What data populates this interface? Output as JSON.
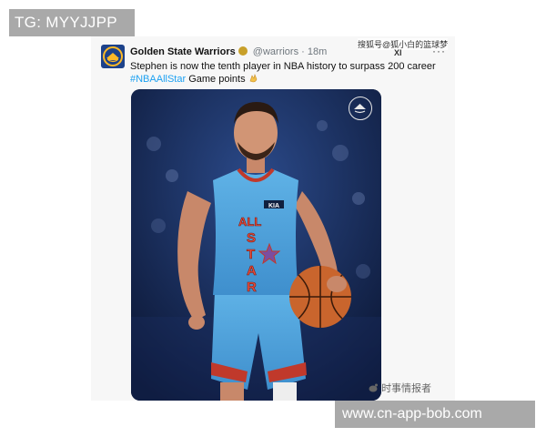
{
  "overlay": {
    "tg_label": "TG: MYYJJPP",
    "url_label": "www.cn-app-bob.com"
  },
  "tweet": {
    "author": "Golden State Warriors",
    "handle": "@warriors",
    "separator": "·",
    "time": "18m",
    "more": "···",
    "text": "Stephen is now the tenth player in NBA history to surpass 200 career",
    "hashtag": "#NBAAllStar",
    "text_tail": "Game points",
    "emoji_name": "clapping-hands-icon",
    "verified_color": "#c8a02a",
    "brand_color": "#1d428a"
  },
  "photo": {
    "jersey_letters": [
      "ALL",
      "S",
      "T",
      "A",
      "R"
    ],
    "sponsor": "KIA"
  },
  "watermarks": {
    "top": "搜狐号@狐小白的篮球梦",
    "top_sub": "XI",
    "bottom": "时事情报者"
  }
}
